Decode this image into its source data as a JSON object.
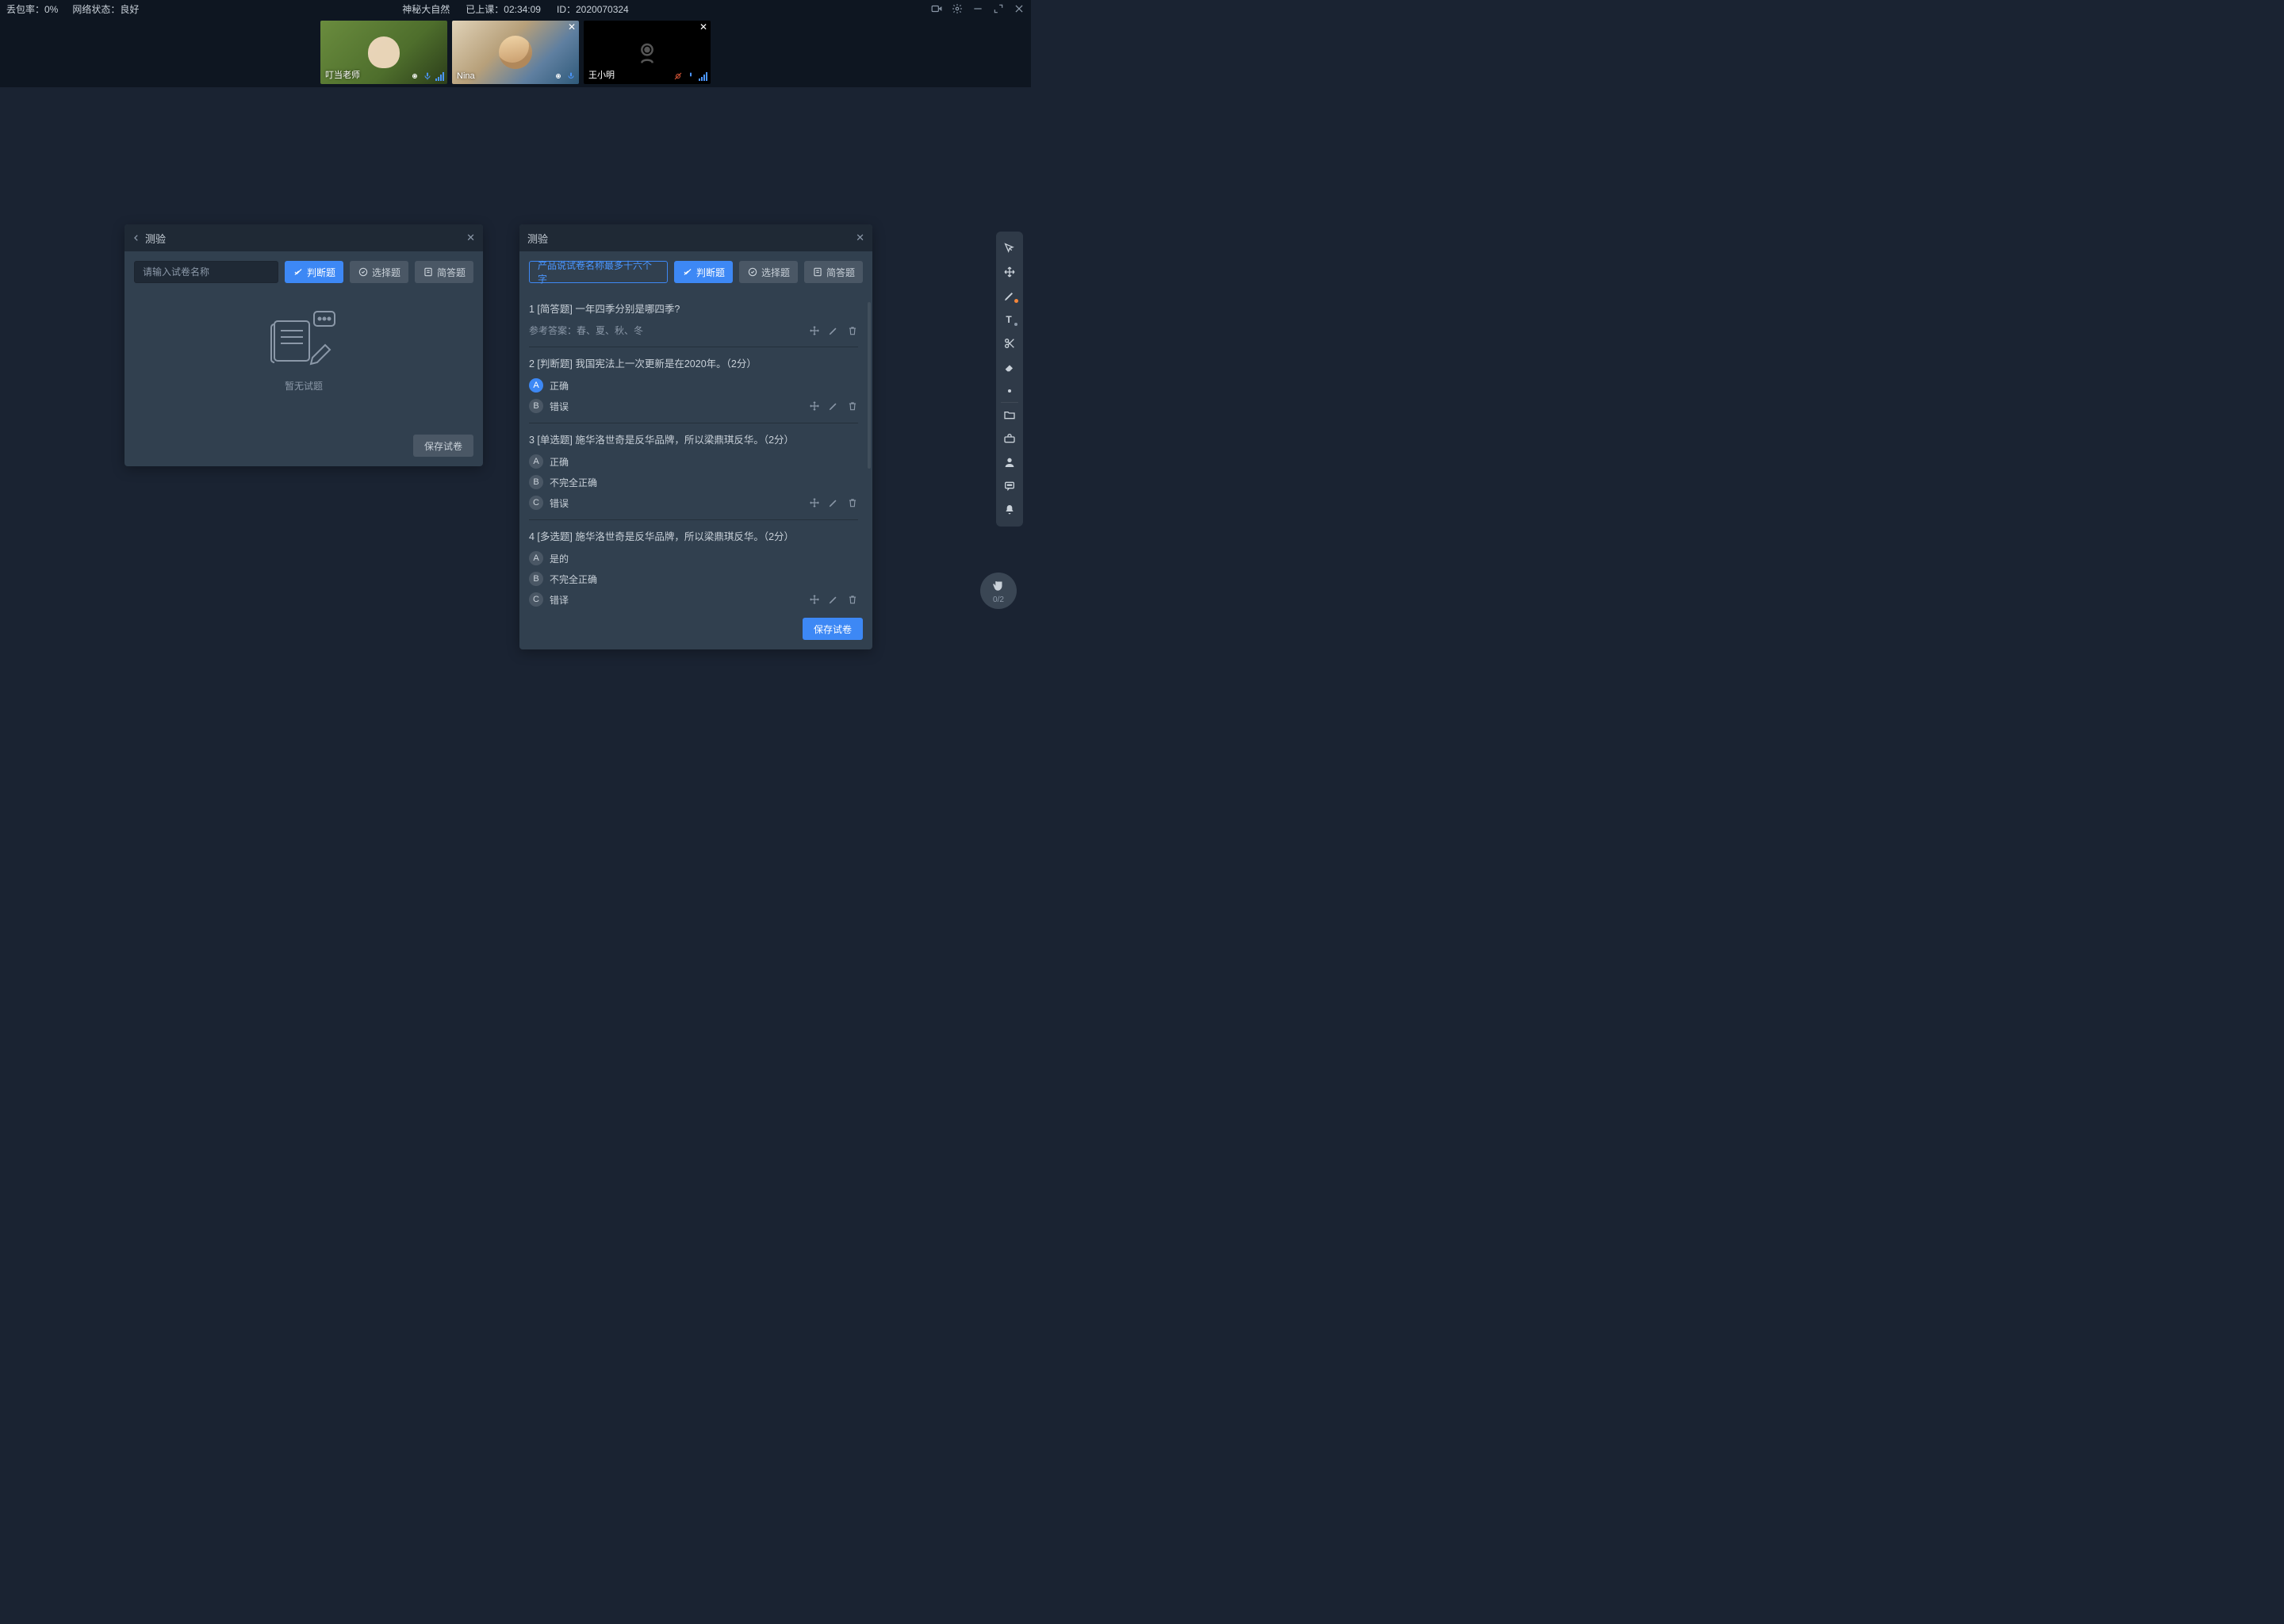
{
  "topbar": {
    "loss_label": "丢包率：0%",
    "net_label": "网络状态：良好",
    "title": "神秘大自然",
    "elapsed_label": "已上课：02:34:09",
    "id_label": "ID：2020070324"
  },
  "videos": [
    {
      "name": "叮当老师",
      "has_close": false,
      "camera_off": false,
      "style": "teacher"
    },
    {
      "name": "Nina",
      "has_close": true,
      "camera_off": false,
      "style": "nina"
    },
    {
      "name": "王小明",
      "has_close": true,
      "camera_off": true,
      "style": "off"
    }
  ],
  "left_panel": {
    "title": "测验",
    "search_placeholder": "请输入试卷名称",
    "tabs": {
      "judge": "判断题",
      "choice": "选择题",
      "short": "简答题"
    },
    "empty_text": "暂无试题",
    "save_label": "保存试卷"
  },
  "right_panel": {
    "title": "测验",
    "name_value": "产品说试卷名称最多十六个字",
    "tabs": {
      "judge": "判断题",
      "choice": "选择题",
      "short": "简答题"
    },
    "ref_label": "参考答案：",
    "save_label": "保存试卷",
    "questions": [
      {
        "index": "1",
        "type": "[简答题]",
        "text": "一年四季分别是哪四季?",
        "reference": "春、夏、秋、冬"
      },
      {
        "index": "2",
        "type": "[判断题]",
        "text": "我国宪法上一次更新是在2020年。（2分）",
        "options": [
          {
            "letter": "A",
            "label": "正确",
            "selected": true
          },
          {
            "letter": "B",
            "label": "错误"
          }
        ]
      },
      {
        "index": "3",
        "type": "[单选题]",
        "text": "施华洛世奇是反华品牌，所以梁鼎琪反华。（2分）",
        "options": [
          {
            "letter": "A",
            "label": "正确"
          },
          {
            "letter": "B",
            "label": "不完全正确"
          },
          {
            "letter": "C",
            "label": "错误"
          }
        ]
      },
      {
        "index": "4",
        "type": "[多选题]",
        "text": "施华洛世奇是反华品牌，所以梁鼎琪反华。（2分）",
        "options": [
          {
            "letter": "A",
            "label": "是的"
          },
          {
            "letter": "B",
            "label": "不完全正确"
          },
          {
            "letter": "C",
            "label": "错译"
          }
        ]
      }
    ]
  },
  "hand_badge": {
    "count": "0/2"
  }
}
